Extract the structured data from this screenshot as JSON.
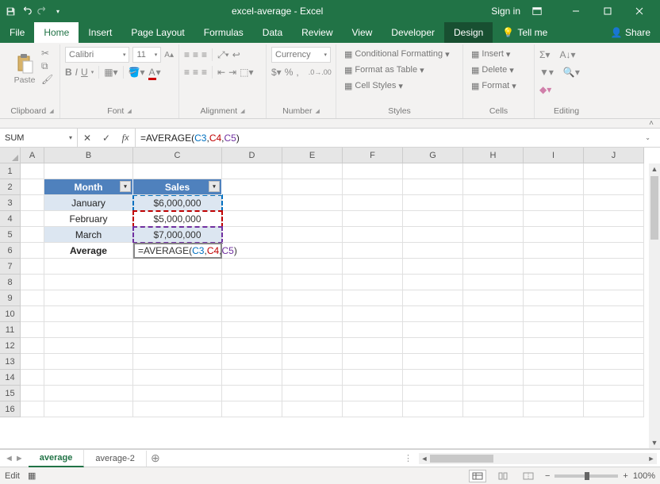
{
  "app_title": "excel-average - Excel",
  "signin": "Sign in",
  "menu": {
    "file": "File",
    "home": "Home",
    "insert": "Insert",
    "page_layout": "Page Layout",
    "formulas": "Formulas",
    "data": "Data",
    "review": "Review",
    "view": "View",
    "developer": "Developer",
    "design": "Design",
    "tell_me": "Tell me",
    "share": "Share"
  },
  "ribbon": {
    "paste": "Paste",
    "clipboard": "Clipboard",
    "font_name": "Calibri",
    "font_size": "11",
    "font": "Font",
    "alignment": "Alignment",
    "number_format": "Currency",
    "number": "Number",
    "cond_fmt": "Conditional Formatting",
    "as_table": "Format as Table",
    "cell_styles": "Cell Styles",
    "styles": "Styles",
    "insert": "Insert",
    "delete": "Delete",
    "format": "Format",
    "cells": "Cells",
    "editing": "Editing"
  },
  "namebox": "SUM",
  "formula_prefix": "=AVERAGE(",
  "formula_a": "C3",
  "formula_b": "C4",
  "formula_c": "C5",
  "formula_close": ")",
  "columns": [
    "A",
    "B",
    "C",
    "D",
    "E",
    "F",
    "G",
    "H",
    "I",
    "J"
  ],
  "rows": [
    "1",
    "2",
    "3",
    "4",
    "5",
    "6",
    "7",
    "8",
    "9",
    "10",
    "11",
    "12",
    "13",
    "14",
    "15",
    "16"
  ],
  "table": {
    "h1": "Month",
    "h2": "Sales",
    "r1c1": "January",
    "r1c2": "$6,000,000",
    "r2c1": "February",
    "r2c2": "$5,000,000",
    "r3c1": "March",
    "r3c2": "$7,000,000",
    "r4c1": "Average"
  },
  "cell_formula_prefix": "=AVERAGE(",
  "sheets": {
    "s1": "average",
    "s2": "average-2"
  },
  "status": {
    "mode": "Edit",
    "zoom": "100%"
  },
  "chart_data": {
    "type": "table",
    "columns": [
      "Month",
      "Sales"
    ],
    "rows": [
      [
        "January",
        6000000
      ],
      [
        "February",
        5000000
      ],
      [
        "March",
        7000000
      ]
    ],
    "formula_cell": {
      "address": "C6",
      "formula": "=AVERAGE(C3,C4,C5)"
    }
  }
}
